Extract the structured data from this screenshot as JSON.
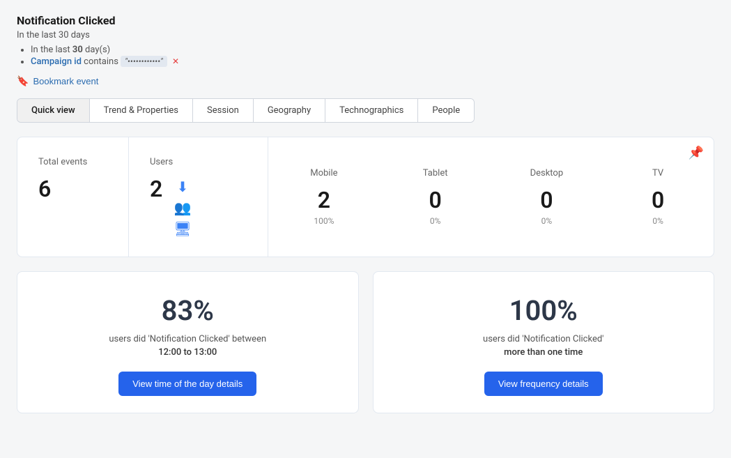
{
  "event": {
    "title": "Notification Clicked",
    "time_range": "In the last 30 days",
    "filters": [
      {
        "label": "In the last",
        "bold": "30",
        "suffix": "day(s)"
      },
      {
        "type": "campaign",
        "link_text": "Campaign id",
        "operator": "contains",
        "value": "••••••••••••"
      }
    ],
    "bookmark_label": "Bookmark event"
  },
  "tabs": [
    {
      "id": "quick-view",
      "label": "Quick view",
      "active": true
    },
    {
      "id": "trend-properties",
      "label": "Trend & Properties",
      "active": false
    },
    {
      "id": "session",
      "label": "Session",
      "active": false
    },
    {
      "id": "geography",
      "label": "Geography",
      "active": false
    },
    {
      "id": "technographics",
      "label": "Technographics",
      "active": false
    },
    {
      "id": "people",
      "label": "People",
      "active": false
    }
  ],
  "stats": {
    "total_events_label": "Total events",
    "total_events_value": "6",
    "users_label": "Users",
    "users_value": "2",
    "devices": [
      {
        "label": "Mobile",
        "value": "2",
        "percent": "100%"
      },
      {
        "label": "Tablet",
        "value": "0",
        "percent": "0%"
      },
      {
        "label": "Desktop",
        "value": "0",
        "percent": "0%"
      },
      {
        "label": "TV",
        "value": "0",
        "percent": "0%"
      }
    ]
  },
  "bottom_cards": [
    {
      "percent": "83%",
      "description": "users did 'Notification Clicked' between",
      "detail": "12:00 to 13:00",
      "button_label": "View time of the day details"
    },
    {
      "percent": "100%",
      "description": "users did 'Notification Clicked'",
      "detail": "more than one time",
      "button_label": "View frequency details"
    }
  ],
  "icons": {
    "bookmark": "🔖",
    "pin": "📌",
    "download": "⬇",
    "users_group": "👥",
    "device": "🖥"
  }
}
